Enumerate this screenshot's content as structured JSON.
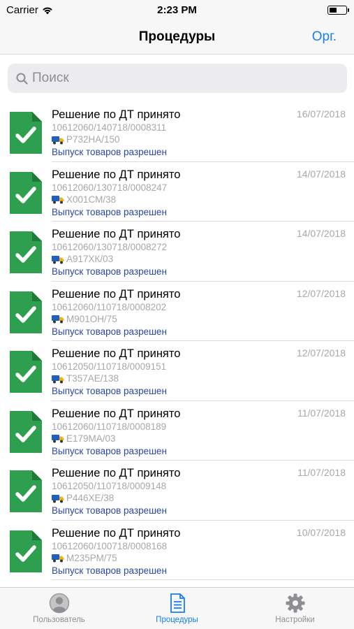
{
  "status_bar": {
    "carrier": "Carrier",
    "time": "2:23 PM"
  },
  "nav": {
    "title": "Процедуры",
    "right_button": "Орг."
  },
  "search": {
    "placeholder": "Поиск"
  },
  "colors": {
    "accent": "#147efb",
    "doc_green": "#2e9e4f",
    "status_blue": "#2a47a8"
  },
  "items": [
    {
      "title": "Решение по ДТ принято",
      "number": "10612060/140718/0008311",
      "vehicle": "Р732НА/150",
      "status": "Выпуск товаров разрешен",
      "date": "16/07/2018"
    },
    {
      "title": "Решение по ДТ принято",
      "number": "10612060/130718/0008247",
      "vehicle": "Х001СМ/38",
      "status": "Выпуск товаров разрешен",
      "date": "14/07/2018"
    },
    {
      "title": "Решение по ДТ принято",
      "number": "10612060/130718/0008272",
      "vehicle": "А917ХК/03",
      "status": "Выпуск товаров разрешен",
      "date": "14/07/2018"
    },
    {
      "title": "Решение по ДТ принято",
      "number": "10612060/110718/0008202",
      "vehicle": "М901ОН/75",
      "status": "Выпуск товаров разрешен",
      "date": "12/07/2018"
    },
    {
      "title": "Решение по ДТ принято",
      "number": "10612050/110718/0009151",
      "vehicle": "Т357АЕ/138",
      "status": "Выпуск товаров разрешен",
      "date": "12/07/2018"
    },
    {
      "title": "Решение по ДТ принято",
      "number": "10612060/110718/0008189",
      "vehicle": "Е179МА/03",
      "status": "Выпуск товаров разрешен",
      "date": "11/07/2018"
    },
    {
      "title": "Решение по ДТ принято",
      "number": "10612050/110718/0009148",
      "vehicle": "Р446ХЕ/38",
      "status": "Выпуск товаров разрешен",
      "date": "11/07/2018"
    },
    {
      "title": "Решение по ДТ принято",
      "number": "10612060/100718/0008168",
      "vehicle": "М235РМ/75",
      "status": "Выпуск товаров разрешен",
      "date": "10/07/2018"
    }
  ],
  "tabs": [
    {
      "label": "Пользователь",
      "icon": "user-icon",
      "active": false
    },
    {
      "label": "Процедуры",
      "icon": "document-icon",
      "active": true
    },
    {
      "label": "Настройки",
      "icon": "gear-icon",
      "active": false
    }
  ]
}
